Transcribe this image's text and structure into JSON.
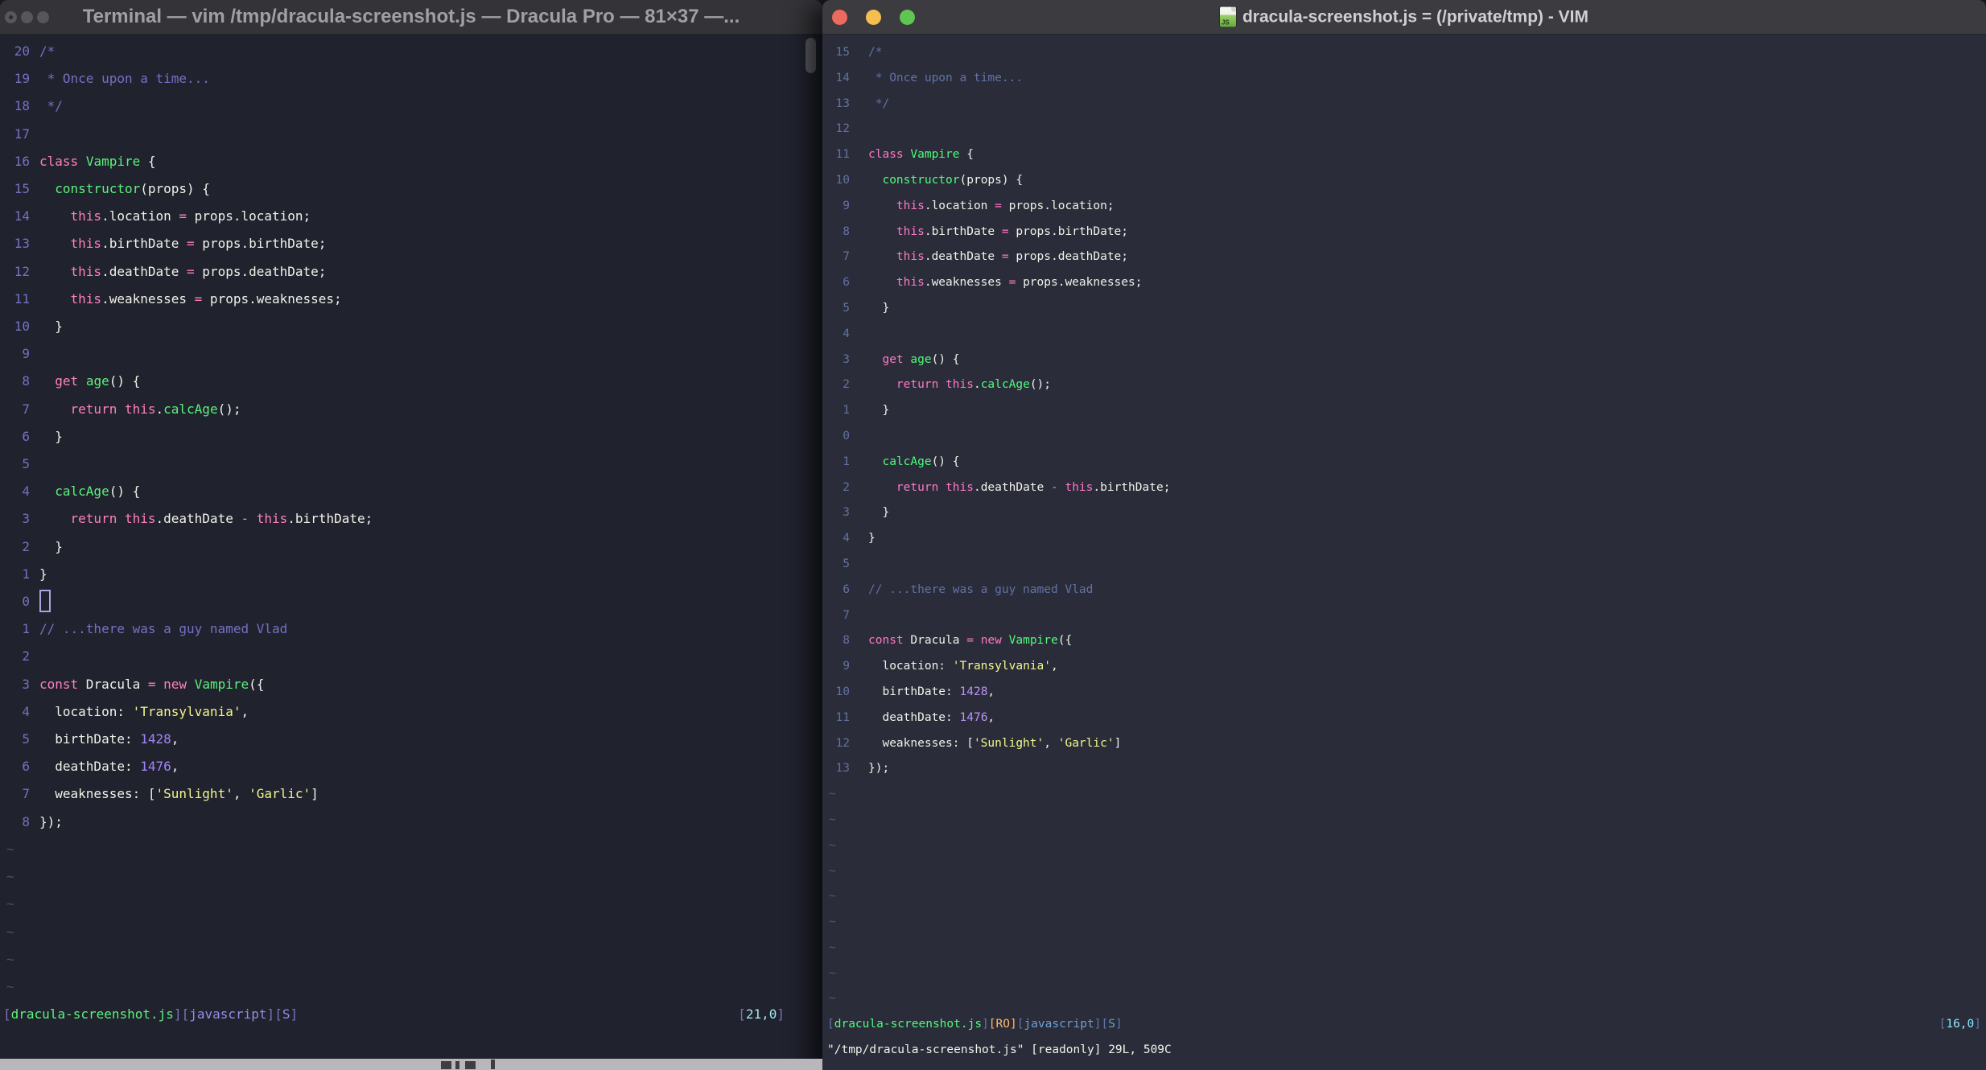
{
  "code_lines": [
    [
      [
        "/*",
        "com"
      ]
    ],
    [
      [
        " * Once upon a time...",
        "com"
      ]
    ],
    [
      [
        " */",
        "com"
      ]
    ],
    [],
    [
      [
        "class",
        "pink"
      ],
      [
        " ",
        "fg"
      ],
      [
        "Vampire",
        "green"
      ],
      [
        " {",
        "fg"
      ]
    ],
    [
      [
        "  ",
        "fg"
      ],
      [
        "constructor",
        "green"
      ],
      [
        "(props) {",
        "fg"
      ]
    ],
    [
      [
        "    ",
        "fg"
      ],
      [
        "this",
        "pink"
      ],
      [
        ".location ",
        "fg"
      ],
      [
        "=",
        "pink"
      ],
      [
        " props.location;",
        "fg"
      ]
    ],
    [
      [
        "    ",
        "fg"
      ],
      [
        "this",
        "pink"
      ],
      [
        ".birthDate ",
        "fg"
      ],
      [
        "=",
        "pink"
      ],
      [
        " props.birthDate;",
        "fg"
      ]
    ],
    [
      [
        "    ",
        "fg"
      ],
      [
        "this",
        "pink"
      ],
      [
        ".deathDate ",
        "fg"
      ],
      [
        "=",
        "pink"
      ],
      [
        " props.deathDate;",
        "fg"
      ]
    ],
    [
      [
        "    ",
        "fg"
      ],
      [
        "this",
        "pink"
      ],
      [
        ".weaknesses ",
        "fg"
      ],
      [
        "=",
        "pink"
      ],
      [
        " props.weaknesses;",
        "fg"
      ]
    ],
    [
      [
        "  }",
        "fg"
      ]
    ],
    [],
    [
      [
        "  ",
        "fg"
      ],
      [
        "get",
        "pink"
      ],
      [
        " ",
        "fg"
      ],
      [
        "age",
        "green"
      ],
      [
        "() {",
        "fg"
      ]
    ],
    [
      [
        "    ",
        "fg"
      ],
      [
        "return",
        "pink"
      ],
      [
        " ",
        "fg"
      ],
      [
        "this",
        "pink"
      ],
      [
        ".",
        "fg"
      ],
      [
        "calcAge",
        "green"
      ],
      [
        "();",
        "fg"
      ]
    ],
    [
      [
        "  }",
        "fg"
      ]
    ],
    [],
    [
      [
        "  ",
        "fg"
      ],
      [
        "calcAge",
        "green"
      ],
      [
        "() {",
        "fg"
      ]
    ],
    [
      [
        "    ",
        "fg"
      ],
      [
        "return",
        "pink"
      ],
      [
        " ",
        "fg"
      ],
      [
        "this",
        "pink"
      ],
      [
        ".deathDate ",
        "fg"
      ],
      [
        "-",
        "pink"
      ],
      [
        " ",
        "fg"
      ],
      [
        "this",
        "pink"
      ],
      [
        ".birthDate;",
        "fg"
      ]
    ],
    [
      [
        "  }",
        "fg"
      ]
    ],
    [
      [
        "}",
        "fg"
      ]
    ],
    [],
    [
      [
        "// ...there was a guy named Vlad",
        "com"
      ]
    ],
    [],
    [
      [
        "const",
        "pink"
      ],
      [
        " Dracula ",
        "fg"
      ],
      [
        "=",
        "pink"
      ],
      [
        " ",
        "fg"
      ],
      [
        "new",
        "pink"
      ],
      [
        " ",
        "fg"
      ],
      [
        "Vampire",
        "green"
      ],
      [
        "({",
        "fg"
      ]
    ],
    [
      [
        "  location: ",
        "fg"
      ],
      [
        "'Transylvania'",
        "yel"
      ],
      [
        ",",
        "fg"
      ]
    ],
    [
      [
        "  birthDate: ",
        "fg"
      ],
      [
        "1428",
        "pur"
      ],
      [
        ",",
        "fg"
      ]
    ],
    [
      [
        "  deathDate: ",
        "fg"
      ],
      [
        "1476",
        "pur"
      ],
      [
        ",",
        "fg"
      ]
    ],
    [
      [
        "  weaknesses: [",
        "fg"
      ],
      [
        "'Sunlight'",
        "yel"
      ],
      [
        ", ",
        "fg"
      ],
      [
        "'Garlic'",
        "yel"
      ],
      [
        "]",
        "fg"
      ]
    ],
    [
      [
        "});",
        "fg"
      ]
    ]
  ],
  "windows": {
    "left": {
      "title": "Terminal — vim /tmp/dracula-screenshot.js — Dracula Pro — 81×37 —...",
      "rel_numbers": [
        "20",
        "19",
        "18",
        "17",
        "16",
        "15",
        "14",
        "13",
        "12",
        "11",
        "10",
        "9",
        "8",
        "7",
        "6",
        "5",
        "4",
        "3",
        "2",
        "1",
        "0",
        "1",
        "2",
        "3",
        "4",
        "5",
        "6",
        "7",
        "8"
      ],
      "cursor_row": 21,
      "cursor_visible": true,
      "tilde_rows": 6,
      "status_left": [
        [
          "[",
          "br"
        ],
        [
          "dracula-screenshot.js",
          "green"
        ],
        [
          "]",
          "br"
        ],
        [
          "[",
          "br"
        ],
        [
          "javascript",
          "vio"
        ],
        [
          "]",
          "br"
        ],
        [
          "[",
          "br"
        ],
        [
          "S",
          "vio"
        ],
        [
          "]",
          "br"
        ]
      ],
      "status_right": [
        [
          "[",
          "br"
        ],
        [
          "21,0",
          "cyan"
        ],
        [
          "]",
          "br"
        ]
      ],
      "cmdline": "",
      "palette": {
        "bg": "#20222D",
        "fg": "#F2F2EA",
        "com": "#7471C4",
        "lnum": "#7471C4",
        "pink": "#FF80BF",
        "green": "#5CF27C",
        "yel": "#F1F58C",
        "pur": "#A285F6",
        "tilde": "#4D5262",
        "br": "#7A72BD",
        "vio": "#968CE8",
        "cyan": "#9FE8F2",
        "orange": "#FFB86C",
        "cursor": "#ACA4DE"
      }
    },
    "right": {
      "title": "dracula-screenshot.js = (/private/tmp) - VIM",
      "icon_label": "JS",
      "rel_numbers": [
        "15",
        "14",
        "13",
        "12",
        "11",
        "10",
        "9",
        "8",
        "7",
        "6",
        "5",
        "4",
        "3",
        "2",
        "1",
        "0",
        "1",
        "2",
        "3",
        "4",
        "5",
        "6",
        "7",
        "8",
        "9",
        "10",
        "11",
        "12",
        "13"
      ],
      "cursor_row": 16,
      "cursor_visible": false,
      "tilde_rows": 9,
      "status_left": [
        [
          "[",
          "br"
        ],
        [
          "dracula-screenshot.js",
          "green"
        ],
        [
          "]",
          "br"
        ],
        [
          "[RO]",
          "orange"
        ],
        [
          "[",
          "br"
        ],
        [
          "javascript",
          "vio"
        ],
        [
          "]",
          "br"
        ],
        [
          "[",
          "br"
        ],
        [
          "S",
          "vio"
        ],
        [
          "]",
          "br"
        ]
      ],
      "status_right": [
        [
          "[",
          "br"
        ],
        [
          "16,0",
          "cyan"
        ],
        [
          "]",
          "br"
        ]
      ],
      "cmdline": "\"/tmp/dracula-screenshot.js\" [readonly] 29L, 509C",
      "palette": {
        "bg": "#2A2C39",
        "fg": "#F2F2EA",
        "com": "#6272A4",
        "lnum": "#6272A4",
        "pink": "#FF79C6",
        "green": "#50FA7B",
        "yel": "#F1FA8C",
        "pur": "#BD93F9",
        "tilde": "#4C587A",
        "br": "#6077AD",
        "vio": "#6FA0D6",
        "cyan": "#8BE9FD",
        "orange": "#FFB86C",
        "cursor": "#F2F2EA"
      }
    }
  }
}
